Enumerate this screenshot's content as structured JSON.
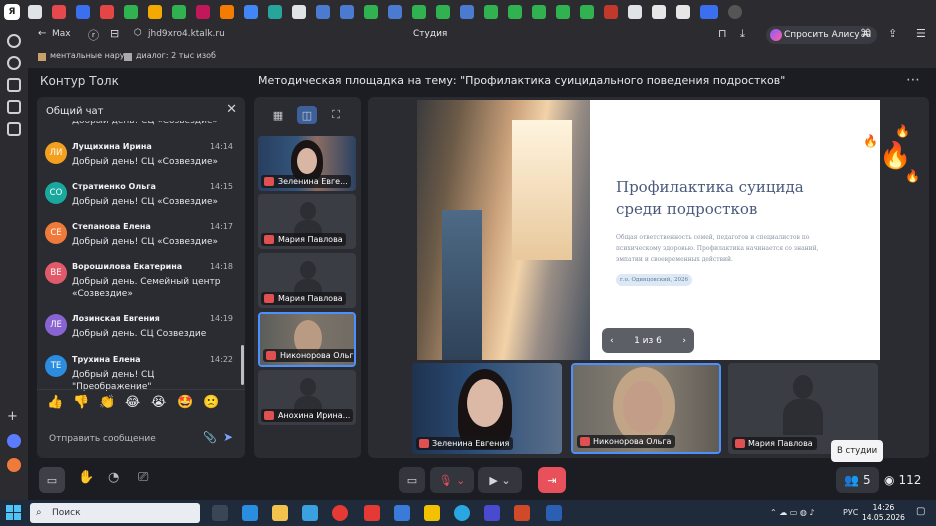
{
  "browser": {
    "back_label": "Max",
    "url": "jhd9xro4.ktalk.ru",
    "page_title": "Студия",
    "alice_label": "Спросить Алису AI",
    "bookmarks": [
      "ментальные нару",
      "диалог: 2 тыс изоб"
    ]
  },
  "app": {
    "brand": "Контур Толк",
    "meeting_title": "Методическая площадка на тему: \"Профилактика суицидального поведения подростков\"",
    "more_icon": "⋯"
  },
  "chat": {
    "title": "Общий чат",
    "cut_text": "Добрый день! СЦ «Созвездие»",
    "messages": [
      {
        "initials": "ЛИ",
        "color": "#f2a01d",
        "name": "Лущихина Ирина",
        "time": "14:14",
        "text": "Добрый день! СЦ «Созвездие»"
      },
      {
        "initials": "СО",
        "color": "#19a89d",
        "name": "Стратиенко Ольга",
        "time": "14:15",
        "text": "Добрый день! СЦ «Созвездие»"
      },
      {
        "initials": "СЕ",
        "color": "#f07a3a",
        "name": "Степанова Елена",
        "time": "14:17",
        "text": "Добрый день! СЦ «Созвездие»"
      },
      {
        "initials": "ВЕ",
        "color": "#e05a6a",
        "name": "Ворошилова Екатерина",
        "time": "14:18",
        "text": "Добрый день. Семейный центр «Созвездие»"
      },
      {
        "initials": "ЛЕ",
        "color": "#8a63d2",
        "name": "Лозинская Евгения",
        "time": "14:19",
        "text": "Добрый день. СЦ Созвездие"
      },
      {
        "initials": "ТЕ",
        "color": "#2b8ce0",
        "name": "Трухина Елена",
        "time": "14:22",
        "text": "Добрый день! СЦ \"Преображение\""
      }
    ],
    "reactions": [
      "👍",
      "👎",
      "👏",
      "😂",
      "😭",
      "🤩",
      "🙁"
    ],
    "input_placeholder": "Отправить сообщение"
  },
  "participants": [
    {
      "name": "Зеленина Евге...",
      "has_video": true
    },
    {
      "name": "Мария Павлова",
      "has_video": false
    },
    {
      "name": "Мария Павлова",
      "has_video": false
    },
    {
      "name": "Никонорова Ольга",
      "has_video": true,
      "active": true
    },
    {
      "name": "Анохина Ирина...",
      "has_video": false
    }
  ],
  "slide": {
    "title": "Профилактика суицида среди подростков",
    "body": "Общая ответственность семей, педагогов и специалистов по психическому здоровью. Профилактика начинается со знаний, эмпатии и своевременных действий.",
    "chip": "г.о. Одинцовский, 2026",
    "pager": "1 из 6"
  },
  "stage_tiles": [
    {
      "name": "Зеленина Евгения"
    },
    {
      "name": "Никонорова Ольга"
    },
    {
      "name": "Мария Павлова"
    }
  ],
  "tooltip": "В студии",
  "toolbar": {
    "participants_count": "5",
    "viewers_count": "112"
  },
  "taskbar": {
    "search_label": "Поиск",
    "lang": "РУС",
    "time": "14:26",
    "date": "14.05.2026"
  },
  "colors": {
    "accent": "#4a90ff",
    "exit": "#e8505b",
    "mic_off": "#e05050"
  }
}
